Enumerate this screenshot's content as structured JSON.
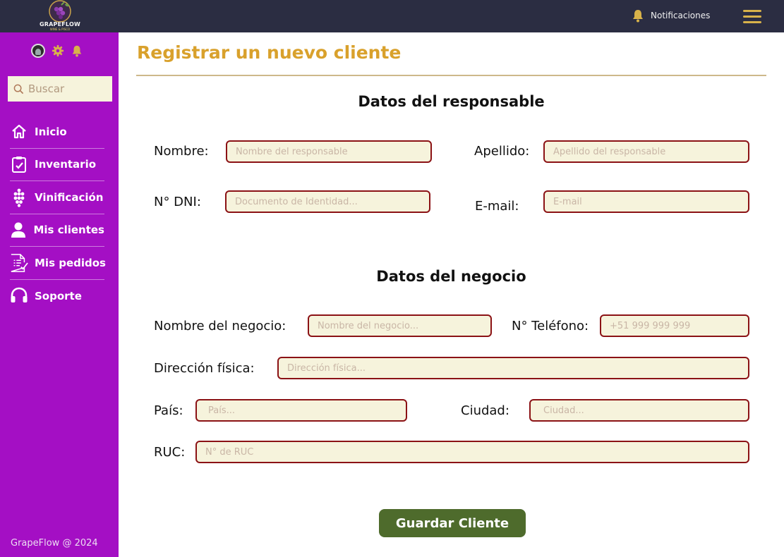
{
  "app": {
    "logo_text": "GRAPEFLOW",
    "logo_subtext": "WINE & PISCO",
    "footer": "GrapeFlow  @ 2024"
  },
  "topbar": {
    "notifications_label": "Notificaciones"
  },
  "sidebar": {
    "search_placeholder": "Buscar",
    "items": [
      {
        "label": "Inicio",
        "icon": "home-icon"
      },
      {
        "label": "Inventario",
        "icon": "clipboard-check-icon"
      },
      {
        "label": "Vinificación",
        "icon": "grapes-icon"
      },
      {
        "label": "Mis clientes",
        "icon": "user-icon"
      },
      {
        "label": "Mis pedidos",
        "icon": "order-list-icon"
      },
      {
        "label": "Soporte",
        "icon": "headset-icon"
      }
    ]
  },
  "page": {
    "title": "Registrar un nuevo cliente",
    "save_label": "Guardar Cliente"
  },
  "responsable": {
    "heading": "Datos del responsable",
    "nombre": {
      "label": "Nombre:",
      "placeholder": "Nombre del responsable"
    },
    "apellido": {
      "label": "Apellido:",
      "placeholder": "Apellido del responsable"
    },
    "dni": {
      "label": "N° DNI:",
      "placeholder": "Documento de Identidad..."
    },
    "email": {
      "label": "E-mail:",
      "placeholder": "E-mail"
    }
  },
  "negocio": {
    "heading": "Datos del  negocio",
    "nombre": {
      "label": "Nombre del negocio:",
      "placeholder": "Nombre del negocio..."
    },
    "telefono": {
      "label": "N° Teléfono:",
      "placeholder": "+51 999 999 999"
    },
    "direccion": {
      "label": "Dirección física:",
      "placeholder": "Dirección física..."
    },
    "pais": {
      "label": "País:",
      "placeholder": "País..."
    },
    "ciudad": {
      "label": "Ciudad:",
      "placeholder": "Ciudad..."
    },
    "ruc": {
      "label": "RUC:",
      "placeholder": "N° de RUC"
    }
  },
  "colors": {
    "topbar": "#2b2d42",
    "sidebar": "#a40fc4",
    "title": "#d9a12c",
    "field_border": "#8b1215",
    "field_bg": "#f6f3dc",
    "button": "#4e6b2c"
  }
}
